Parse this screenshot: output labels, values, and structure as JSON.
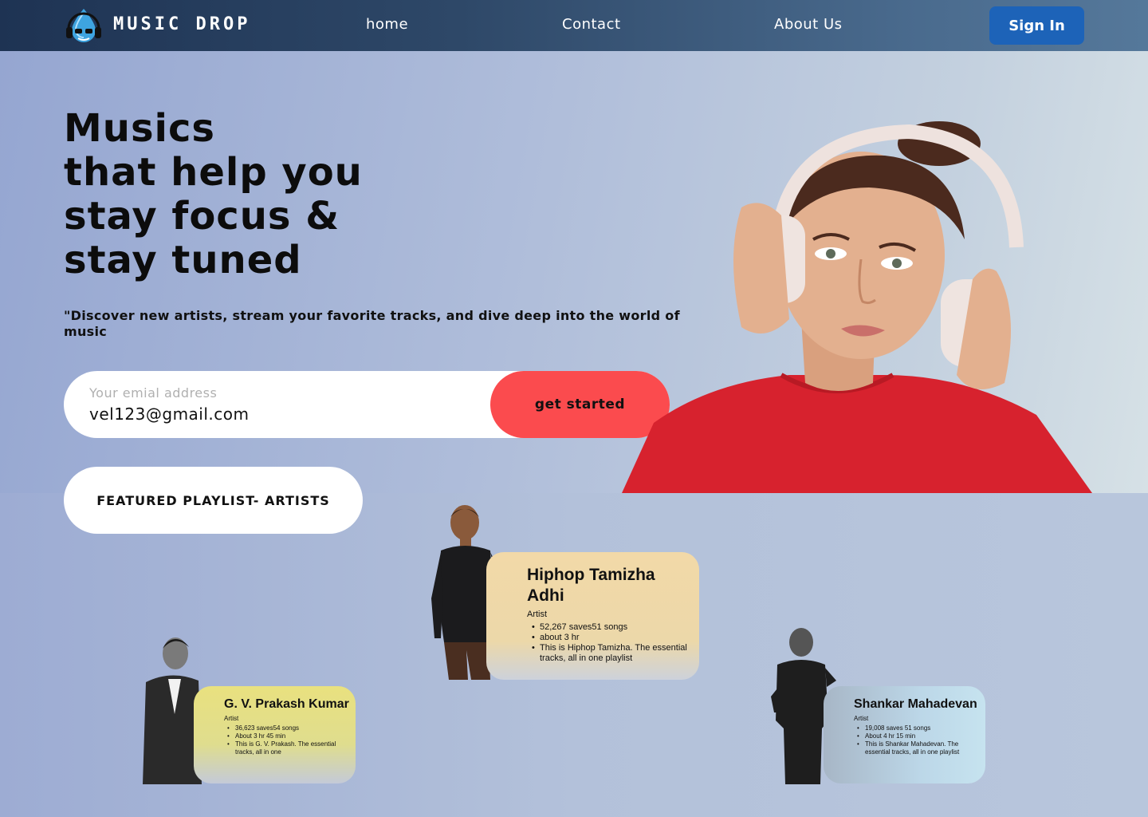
{
  "nav": {
    "brand": "MUSIC DROP",
    "links": [
      "home",
      "Contact",
      "About Us"
    ],
    "signin": "Sign In"
  },
  "hero": {
    "headline": [
      "Musics",
      "that help you",
      "stay focus &",
      "stay tuned"
    ],
    "tagline": "\"Discover new artists, stream your favorite tracks, and dive deep into the world of music",
    "email_placeholder": "Your emial address",
    "email_value": "vel123@gmail.com",
    "cta": "get started"
  },
  "featured": {
    "label": "FEATURED PLAYLIST- ARTISTS"
  },
  "artists": [
    {
      "name": "Hiphop Tamizha Adhi",
      "role": "Artist",
      "details": [
        "52,267 saves51 songs",
        "about 3 hr",
        "This is Hiphop Tamizha. The essential tracks, all in one playlist"
      ]
    },
    {
      "name": "G. V. Prakash Kumar",
      "role": "Artist",
      "details": [
        "36,623 saves54 songs",
        "About 3 hr 45 min",
        "This is G. V. Prakash. The essential tracks, all in one"
      ]
    },
    {
      "name": "Shankar Mahadevan",
      "role": "Artist",
      "details": [
        "19,008 saves 51 songs",
        "About 4 hr 15 min",
        "This is Shankar Mahadevan. The essential tracks, all in one playlist"
      ]
    }
  ],
  "colors": {
    "nav_start": "#1e3353",
    "nav_end": "#55789a",
    "signin_bg": "#1d63b8",
    "cta_bg": "#fb4b4e",
    "card_hiphop": "#f2d9a8",
    "card_gv": "#e9e17f",
    "card_shankar": "#bcd7e8"
  },
  "icons": [
    "headphone-droplet-logo-icon"
  ]
}
